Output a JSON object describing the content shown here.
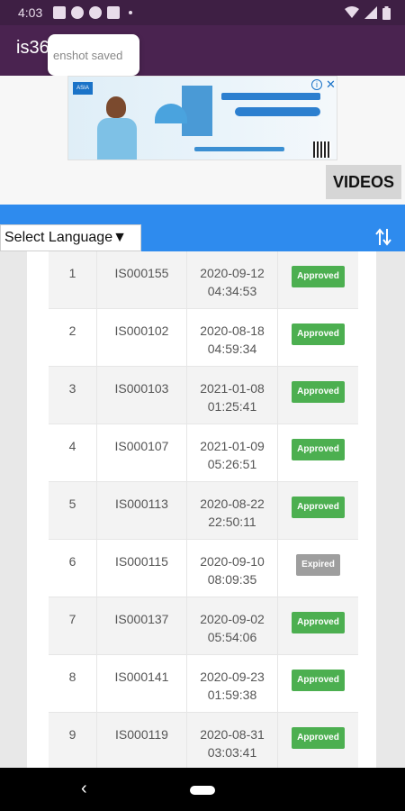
{
  "status_bar": {
    "time": "4:03",
    "icons": [
      "image-icon",
      "heart-icon",
      "heart-icon",
      "message-icon",
      "dot-icon"
    ],
    "right_icons": [
      "wifi-icon",
      "signal-icon",
      "battery-icon"
    ]
  },
  "app_bar": {
    "title": "is36",
    "toast": "enshot saved"
  },
  "ad": {
    "logo_text": "ASIA",
    "info_glyph": "i",
    "close_glyph": "✕"
  },
  "videos_button": "VIDEOS",
  "language_select": {
    "label": "Select Language",
    "arrow": "▼"
  },
  "colors": {
    "approved": "#4caf50",
    "expired": "#9e9e9e",
    "accent": "#2e8bee",
    "app_bar": "#4a2350"
  },
  "table": {
    "rows": [
      {
        "num": "1",
        "id": "IS000155",
        "date": "2020-09-12",
        "time": "04:34:53",
        "status": "Approved"
      },
      {
        "num": "2",
        "id": "IS000102",
        "date": "2020-08-18",
        "time": "04:59:34",
        "status": "Approved"
      },
      {
        "num": "3",
        "id": "IS000103",
        "date": "2021-01-08",
        "time": "01:25:41",
        "status": "Approved"
      },
      {
        "num": "4",
        "id": "IS000107",
        "date": "2021-01-09",
        "time": "05:26:51",
        "status": "Approved"
      },
      {
        "num": "5",
        "id": "IS000113",
        "date": "2020-08-22",
        "time": "22:50:11",
        "status": "Approved"
      },
      {
        "num": "6",
        "id": "IS000115",
        "date": "2020-09-10",
        "time": "08:09:35",
        "status": "Expired"
      },
      {
        "num": "7",
        "id": "IS000137",
        "date": "2020-09-02",
        "time": "05:54:06",
        "status": "Approved"
      },
      {
        "num": "8",
        "id": "IS000141",
        "date": "2020-09-23",
        "time": "01:59:38",
        "status": "Approved"
      },
      {
        "num": "9",
        "id": "IS000119",
        "date": "2020-08-31",
        "time": "03:03:41",
        "status": "Approved"
      }
    ]
  },
  "nav": {
    "back_glyph": "‹"
  }
}
